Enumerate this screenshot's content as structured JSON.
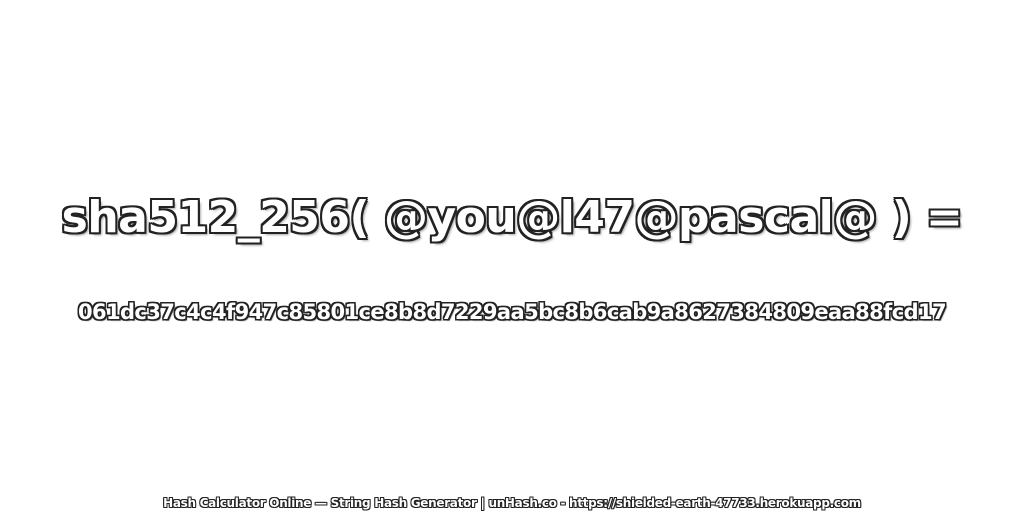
{
  "expression": "sha512_256( @you@l47@pascal@ ) =",
  "hash": "061dc37c4c4f947c85801ce8b8d7229aa5bc8b6cab9a8627384809eaa88fcd17",
  "footer": "Hash Calculator Online — String Hash Generator | unHash.co - https://shielded-earth-47733.herokuapp.com"
}
